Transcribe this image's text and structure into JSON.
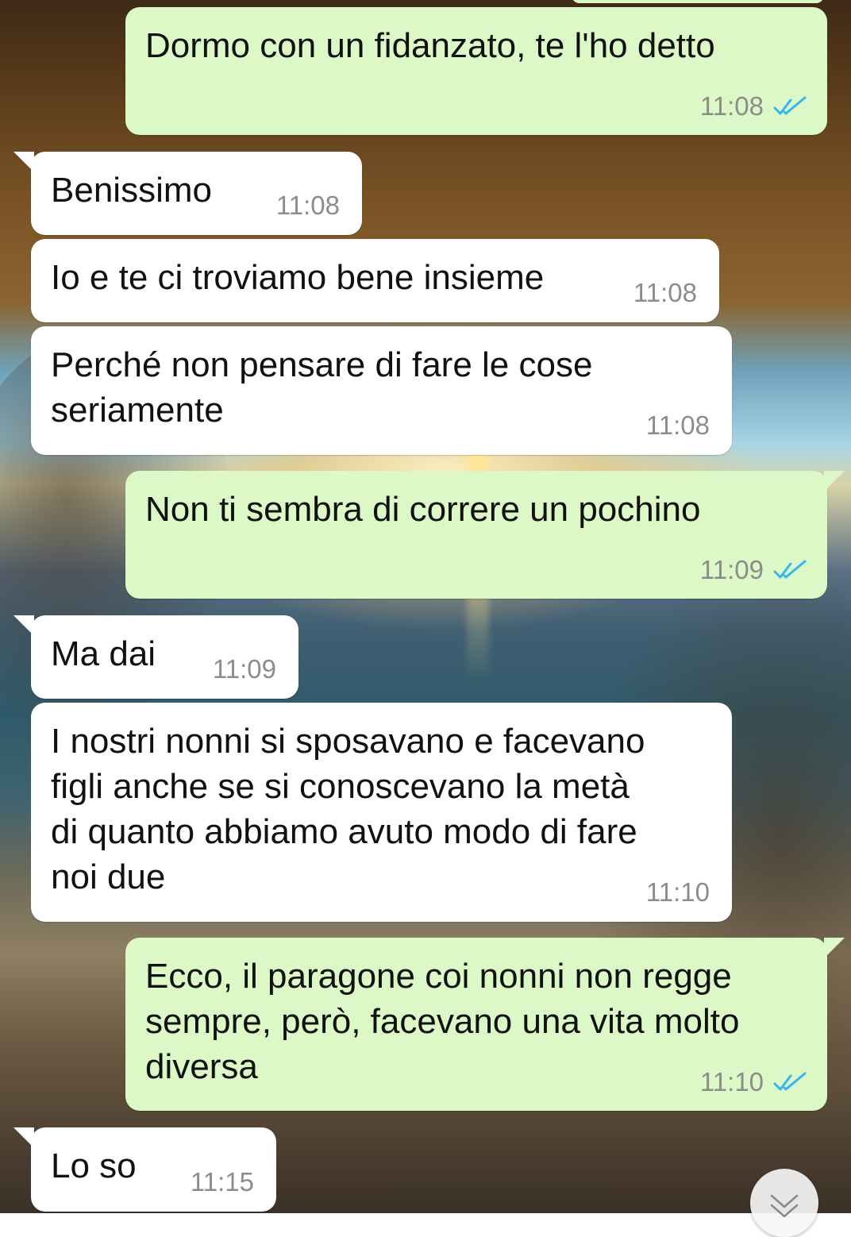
{
  "colors": {
    "outgoing_bubble": "#dcf8c6",
    "incoming_bubble": "#ffffff",
    "timestamp": "#8c8c8c",
    "read_ticks": "#34b7f1"
  },
  "icons": {
    "read_receipt": "double-check-icon",
    "scroll_down": "chevron-down-icon"
  },
  "messages": [
    {
      "direction": "out",
      "text": "Dormo con un fidanzato, te l'ho detto",
      "time": "11:08",
      "read": true
    },
    {
      "direction": "in",
      "text": "Benissimo",
      "time": "11:08"
    },
    {
      "direction": "in",
      "text": "Io e te ci troviamo bene insieme",
      "time": "11:08"
    },
    {
      "direction": "in",
      "text": "Perché non pensare di fare le cose\nseriamente",
      "time": "11:08"
    },
    {
      "direction": "out",
      "text": "Non ti sembra di correre un pochino",
      "time": "11:09",
      "read": true
    },
    {
      "direction": "in",
      "text": "Ma dai",
      "time": "11:09"
    },
    {
      "direction": "in",
      "text": "I nostri nonni si sposavano e facevano\nfigli anche se si conoscevano la metà\ndi quanto abbiamo avuto modo di fare\nnoi due",
      "time": "11:10"
    },
    {
      "direction": "out",
      "text": "Ecco, il paragone coi nonni non regge\nsempre, però, facevano una vita molto\ndiversa",
      "time": "11:10",
      "read": true
    },
    {
      "direction": "in",
      "text": "Lo so",
      "time": "11:15"
    }
  ]
}
